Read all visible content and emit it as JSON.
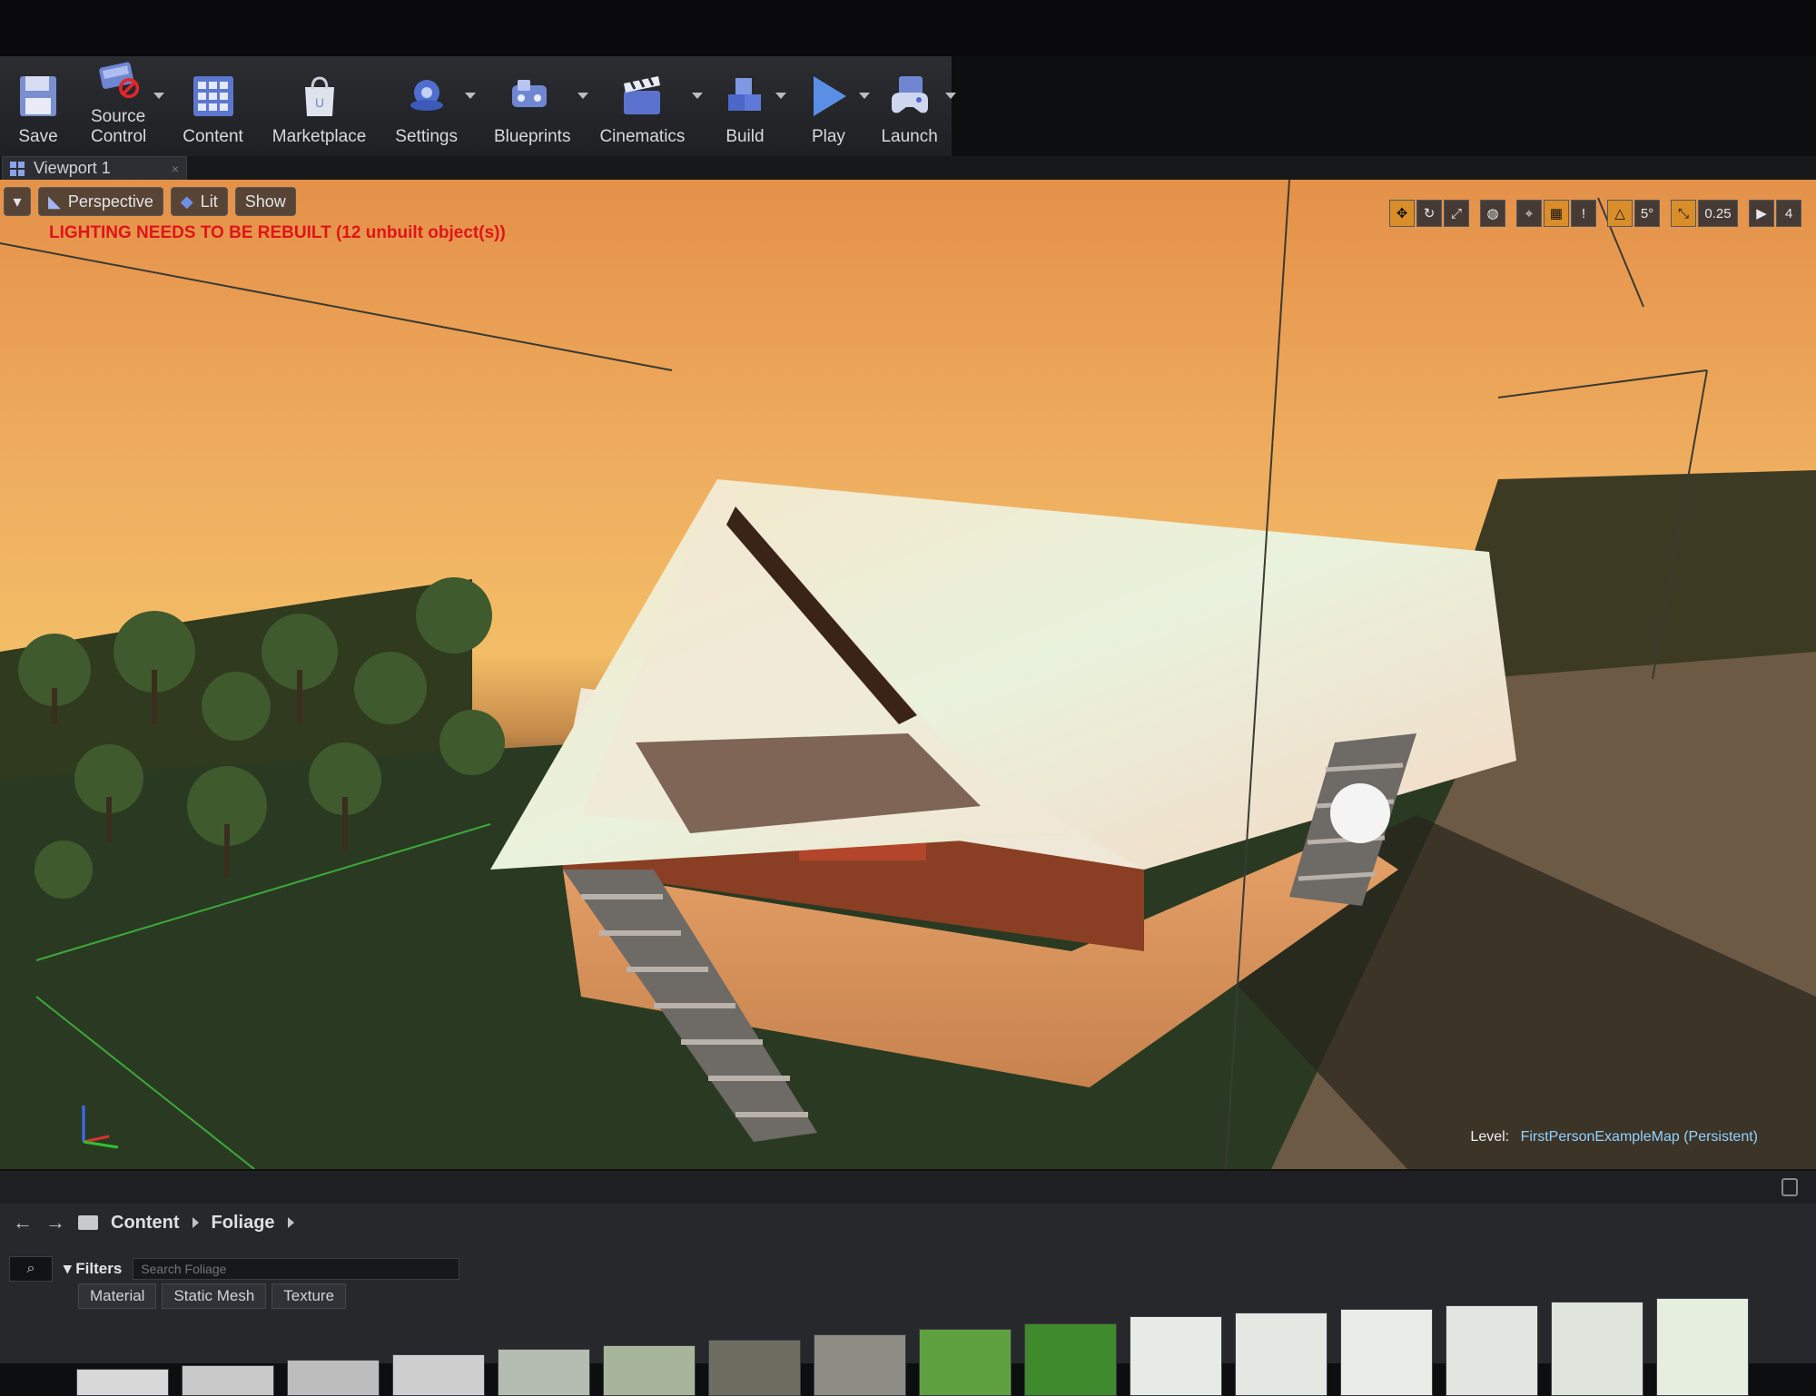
{
  "toolbar": {
    "buttons": [
      {
        "label": "Save",
        "icon": "floppy-disk-icon"
      },
      {
        "label": "Source Control",
        "icon": "source-control-icon"
      },
      {
        "label": "Content",
        "icon": "content-grid-icon"
      },
      {
        "label": "Marketplace",
        "icon": "marketplace-bag-icon"
      },
      {
        "label": "Settings",
        "icon": "gears-icon"
      },
      {
        "label": "Blueprints",
        "icon": "blueprints-icon"
      },
      {
        "label": "Cinematics",
        "icon": "clapperboard-icon"
      },
      {
        "label": "Build",
        "icon": "build-blocks-icon"
      },
      {
        "label": "Play",
        "icon": "play-icon"
      },
      {
        "label": "Launch",
        "icon": "gamepad-icon"
      }
    ]
  },
  "viewport": {
    "tab_label": "Viewport 1",
    "options": {
      "perspective": "Perspective",
      "lit": "Lit",
      "show": "Show"
    },
    "warning": "LIGHTING NEEDS TO BE REBUILT (12 unbuilt object(s))",
    "snap": {
      "rotation": "5°",
      "scale": "0.25",
      "camera_speed": "4"
    },
    "level_label": "Level:",
    "level_name": "FirstPersonExampleMap (Persistent)"
  },
  "content_browser": {
    "path": [
      "Content",
      "Foliage"
    ],
    "filters_label": "Filters",
    "search_placeholder": "Search Foliage",
    "filter_chips": [
      "Material",
      "Static Mesh",
      "Texture"
    ]
  },
  "colors": {
    "sky_top": "#e49148",
    "sky_horizon": "#f3bd66",
    "warning": "#e0141a",
    "level_name": "#8fd2ff",
    "toolbar_bg": "#2b2d31",
    "active_snap": "#d98e2a"
  }
}
